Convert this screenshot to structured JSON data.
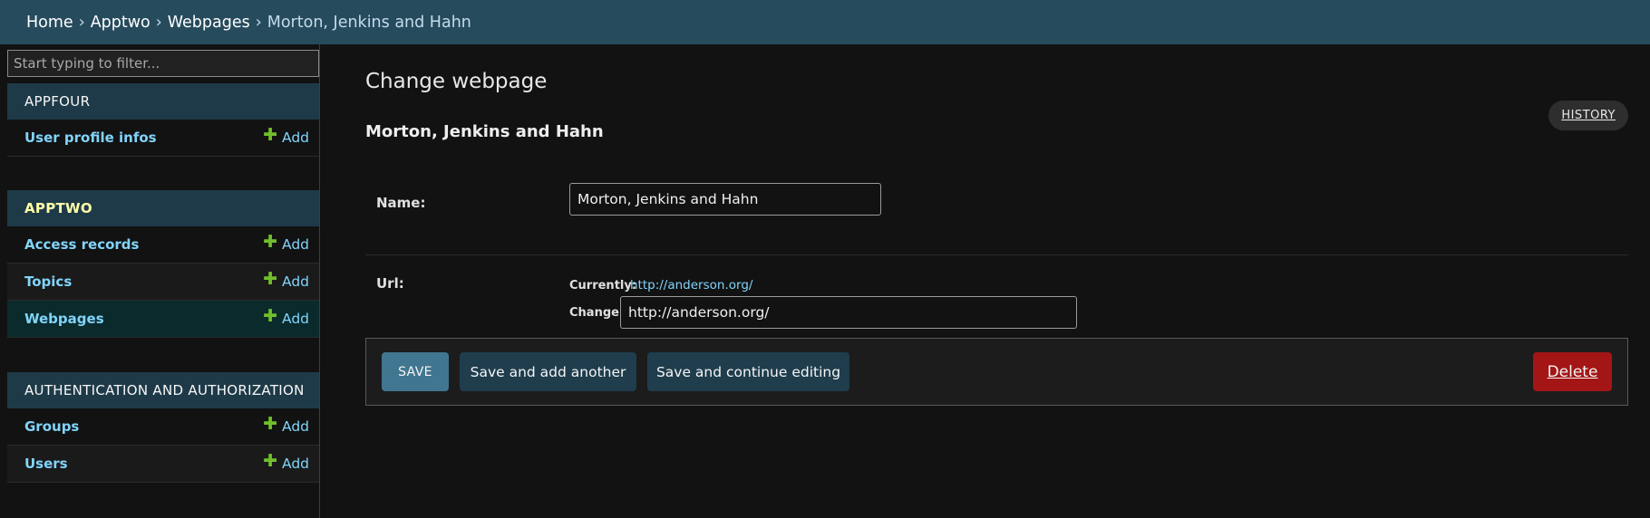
{
  "breadcrumbs": {
    "home": "Home",
    "sep": "›",
    "app": "Apptwo",
    "model": "Webpages",
    "current": "Morton, Jenkins and Hahn"
  },
  "sidebar": {
    "filter_placeholder": "Start typing to filter...",
    "add_label": "Add",
    "modules": [
      {
        "caption": "APPFOUR",
        "models": [
          {
            "name": "User profile infos"
          }
        ]
      },
      {
        "caption": "APPTWO",
        "models": [
          {
            "name": "Access records"
          },
          {
            "name": "Topics"
          },
          {
            "name": "Webpages"
          }
        ]
      },
      {
        "caption": "AUTHENTICATION AND AUTHORIZATION",
        "models": [
          {
            "name": "Groups"
          },
          {
            "name": "Users"
          }
        ]
      }
    ]
  },
  "main": {
    "heading": "Change webpage",
    "object_title": "Morton, Jenkins and Hahn",
    "history_label": "HISTORY",
    "fields": {
      "name": {
        "label": "Name:",
        "value": "Morton, Jenkins and Hahn"
      },
      "url": {
        "label": "Url:",
        "currently_label": "Currently:",
        "currently_value": "http://anderson.org/",
        "change_label": "Change:",
        "value": "http://anderson.org/"
      }
    },
    "buttons": {
      "save": "SAVE",
      "save_add_another": "Save and add another",
      "save_continue": "Save and continue editing",
      "delete": "Delete"
    }
  },
  "colors": {
    "header_bg": "#264b5d",
    "module_caption_bg": "#1e3a48",
    "link": "#81d4fa",
    "add_icon": "#70bf2b",
    "save_button": "#417690",
    "delete_button": "#a41515"
  }
}
